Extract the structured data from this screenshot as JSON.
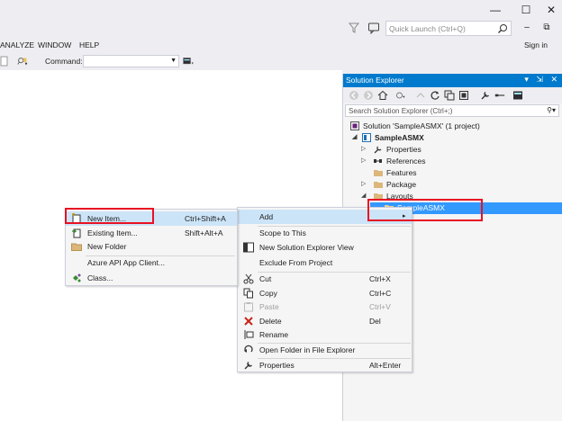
{
  "window": {
    "minimize": "—",
    "maximize": "☐",
    "close": "✕",
    "quick_launch_placeholder": "Quick Launch (Ctrl+Q)",
    "restore": "⧉"
  },
  "menu": {
    "items": [
      "ANALYZE",
      "WINDOW",
      "HELP"
    ],
    "sign_in": "Sign in"
  },
  "toolbar": {
    "command_label": "Command:",
    "command_value": ""
  },
  "solution_explorer": {
    "title": "Solution Explorer",
    "title_tools": "▾ ⇲ ✕",
    "search_placeholder": "Search Solution Explorer (Ctrl+;)",
    "tree": {
      "solution": "Solution 'SampleASMX' (1 project)",
      "project": "SampleASMX",
      "properties": "Properties",
      "references": "References",
      "features": "Features",
      "package": "Package",
      "layouts": "Layouts",
      "selected": "SampleASMX"
    }
  },
  "add_submenu": {
    "items": [
      {
        "label": "New Item...",
        "shortcut": "Ctrl+Shift+A",
        "icon": "new-item-icon"
      },
      {
        "label": "Existing Item...",
        "shortcut": "Shift+Alt+A",
        "icon": "existing-item-icon"
      },
      {
        "label": "New Folder",
        "shortcut": "",
        "icon": "folder-icon"
      },
      {
        "label": "Azure API App Client...",
        "shortcut": "",
        "icon": ""
      },
      {
        "label": "Class...",
        "shortcut": "",
        "icon": "class-icon"
      }
    ]
  },
  "context_menu": {
    "add": "Add",
    "scope": "Scope to This",
    "new_view": "New Solution Explorer View",
    "exclude": "Exclude From Project",
    "cut": "Cut",
    "cut_sc": "Ctrl+X",
    "copy": "Copy",
    "copy_sc": "Ctrl+C",
    "paste": "Paste",
    "paste_sc": "Ctrl+V",
    "delete": "Delete",
    "delete_sc": "Del",
    "rename": "Rename",
    "open_folder": "Open Folder in File Explorer",
    "properties": "Properties",
    "properties_sc": "Alt+Enter"
  },
  "colors": {
    "accent": "#007acc",
    "highlight": "#3399ff",
    "annotation": "#e81123"
  }
}
